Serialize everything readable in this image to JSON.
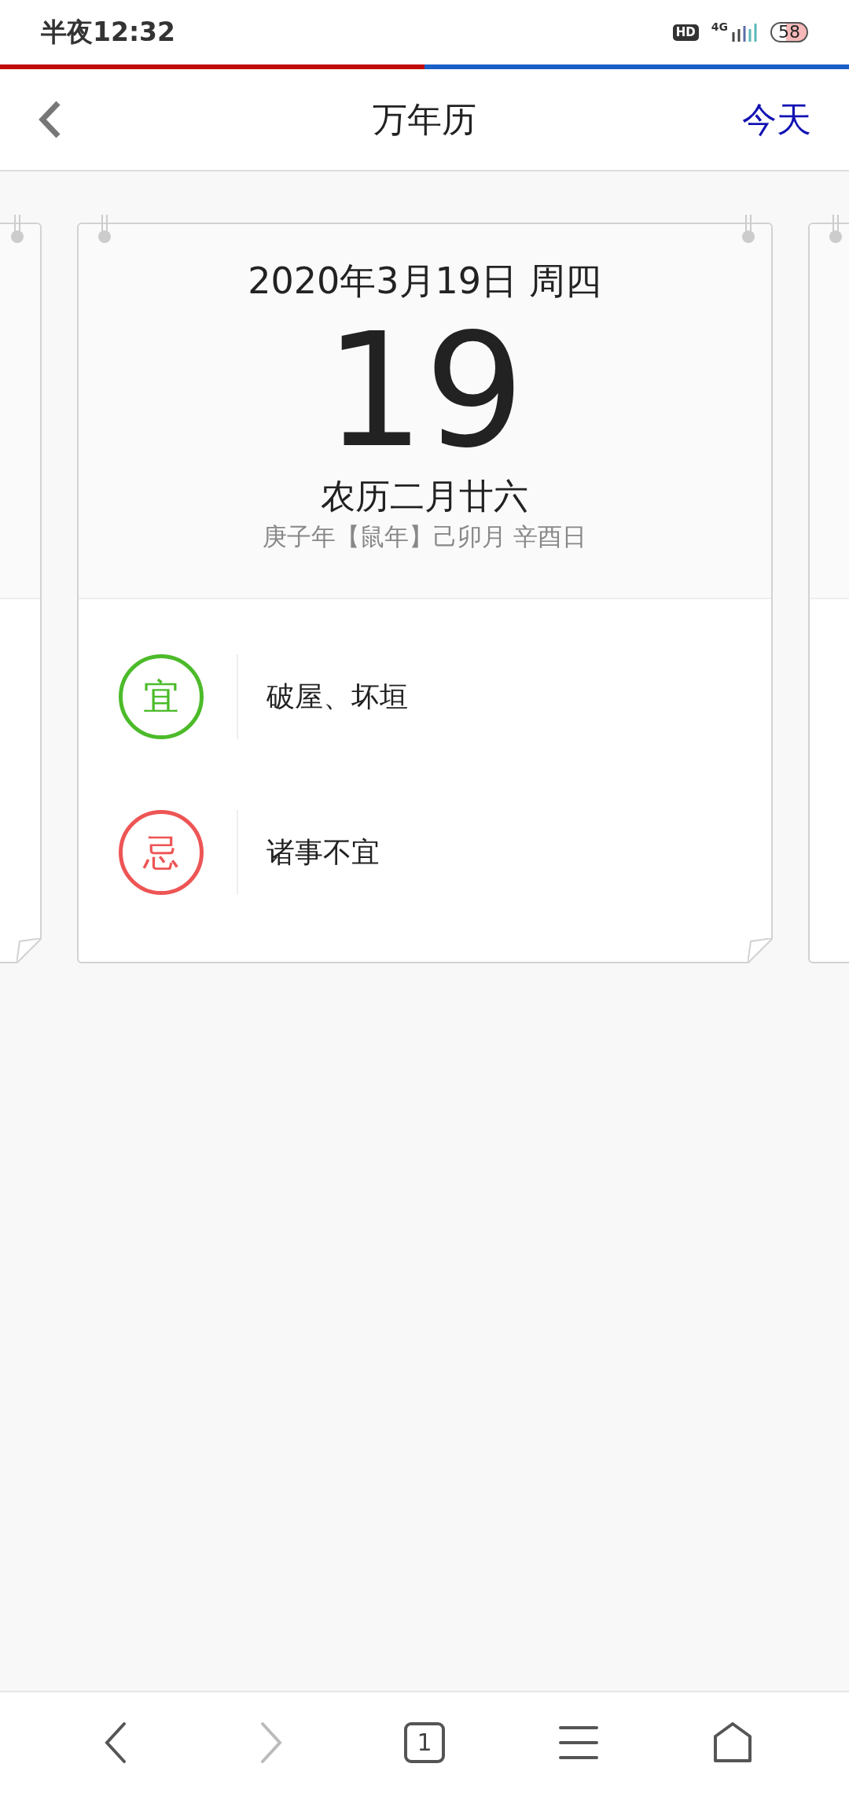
{
  "status_bar": {
    "time": "半夜12:32",
    "hd": "HD",
    "network": "4G",
    "battery": "58"
  },
  "header": {
    "title": "万年历",
    "today": "今天"
  },
  "card": {
    "date_line": "2020年3月19日 周四",
    "day": "19",
    "lunar": "农历二月廿六",
    "ganzhi": "庚子年【鼠年】己卯月 辛酉日",
    "items": [
      {
        "kind": "good",
        "badge": "宜",
        "text": "破屋、坏垣"
      },
      {
        "kind": "bad",
        "badge": "忌",
        "text": "诸事不宜"
      }
    ]
  },
  "bottom_nav": [
    {
      "kind": "back",
      "disabled": false
    },
    {
      "kind": "forward",
      "disabled": true
    },
    {
      "kind": "tabs",
      "label": "1",
      "disabled": false
    },
    {
      "kind": "menu",
      "disabled": false
    },
    {
      "kind": "home",
      "disabled": false
    }
  ]
}
